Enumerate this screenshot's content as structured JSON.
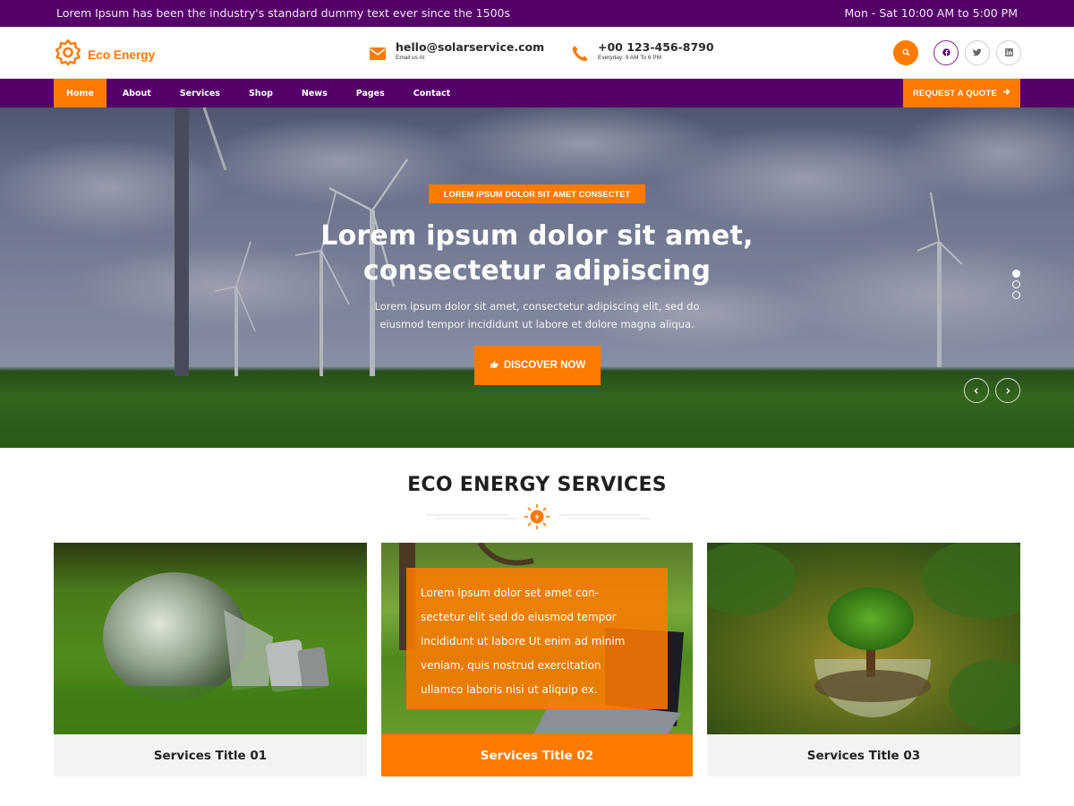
{
  "topbar": {
    "tagline": "Lorem Ipsum has been the industry's standard dummy text ever since the 1500s",
    "hours": "Mon - Sat 10:00 AM to 5:00 PM"
  },
  "header": {
    "logo_text": "Eco Energy",
    "email": {
      "value": "hello@solarservice.com",
      "label": "Email us At",
      "icon": "envelope-icon"
    },
    "phone": {
      "value": "+00 123-456-8790",
      "label": "Everyday: 9 AM To 6 PM",
      "icon": "phone-icon"
    },
    "search_icon": "search-icon",
    "socials": [
      "facebook-icon",
      "twitter-icon",
      "linkedin-icon"
    ]
  },
  "nav": {
    "items": [
      {
        "label": "Home",
        "active": true
      },
      {
        "label": "About"
      },
      {
        "label": "Services"
      },
      {
        "label": "Shop"
      },
      {
        "label": "News"
      },
      {
        "label": "Pages"
      },
      {
        "label": "Contact"
      }
    ],
    "cta": "REQUEST A QUOTE",
    "cta_icon": "arrow-right-icon"
  },
  "hero": {
    "badge": "LOREM IPSUM DOLOR SIT AMET CONSECTET",
    "title_line1": "Lorem ipsum dolor sit amet,",
    "title_line2": "consectetur adipiscing",
    "text_line1": "Lorem ipsum dolor sit amet, consectetur adipiscing elit, sed do",
    "text_line2": "eiusmod tempor incididunt ut labore et dolore magna aliqua.",
    "button": "DISCOVER NOW",
    "button_icon": "hand-pointer-icon",
    "slides_total": 3,
    "active_slide": 1,
    "prev_icon": "chevron-left-icon",
    "next_icon": "chevron-right-icon"
  },
  "services": {
    "title": "ECO ENERGY SERVICES",
    "divider_icon": "sun-bolt-icon",
    "cards": [
      {
        "title": "Services Title 01",
        "image": "light bulb on grass"
      },
      {
        "title": "Services Title 02",
        "image": "laptop on grass",
        "highlight": true,
        "overlay_lines": [
          "Lorem ipsum dolor set amet con-",
          "sectetur elit sed do eiusmod tempor",
          "incididunt ut labore Ut enim ad minim",
          "veniam, quis nostrud exercitation",
          "ullamco laboris nisi ut aliquip ex."
        ]
      },
      {
        "title": "Services Title 03",
        "image": "tree in glass sphere"
      }
    ]
  },
  "colors": {
    "brand_purple": "#540068",
    "accent_orange": "#ff7a00",
    "card_gray": "#f3f3f3"
  }
}
